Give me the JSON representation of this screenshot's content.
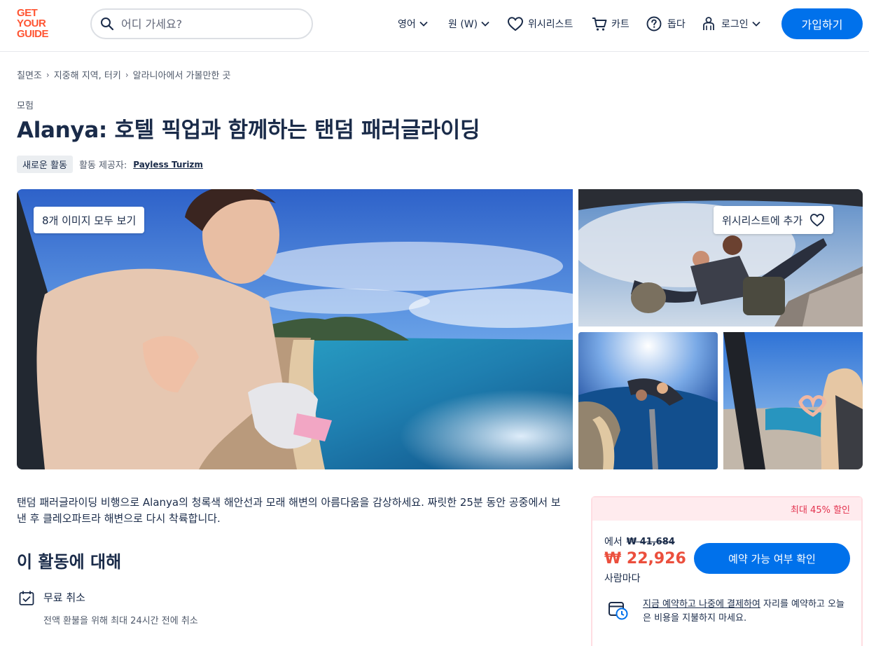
{
  "header": {
    "logo_lines": [
      "GET",
      "YOUR",
      "GUIDE"
    ],
    "search_placeholder": "어디 가세요?",
    "language_label": "영어",
    "currency_label": "원 (W)",
    "wishlist_label": "위시리스트",
    "cart_label": "카트",
    "help_label": "돕다",
    "login_label": "로그인",
    "signup_label": "가입하기"
  },
  "breadcrumb": [
    "칠면조",
    "지중해 지역, 터키",
    "알라니아에서 가볼만한 곳"
  ],
  "category": "모험",
  "title": "Alanya: 호텔 픽업과 함께하는 탠덤 패러글라이딩",
  "badge": "새로운 활동",
  "provider_label": "활동 제공자:",
  "provider_name": "Payless Turizm",
  "gallery": {
    "see_all_label": "8개 이미지 모두 보기",
    "wishlist_add_label": "위시리스트에 추가"
  },
  "description": "탠덤 패러글라이딩 비행으로 Alanya의 청록색 해안선과 모래 해변의 아름다움을 감상하세요. 짜릿한 25분 동안 공중에서 보낸 후 클레오파트라 해변으로 다시 착륙합니다.",
  "about": {
    "title": "이 활동에 대해",
    "feature_title": "무료 취소",
    "feature_sub": "전액 환불을 위해 최대 24시간 전에 취소"
  },
  "booking": {
    "discount_label": "최대 45% 할인",
    "from_label": "에서",
    "old_price": "₩ 41,684",
    "new_price": "₩ 22,926",
    "per_person": "사람마다",
    "check_button": "예약 가능 여부 확인",
    "rnpl_link": "지금 예약하고 나중에 결제하여",
    "rnpl_rest": " 자리를 예약하고 오늘은 비용을 지불하지 마세요."
  },
  "colors": {
    "brand": "#ff5533",
    "primary_button": "#0071eb",
    "price": "#eb4f3d",
    "discount_bg": "#ffebee",
    "text": "#1a2b49"
  }
}
